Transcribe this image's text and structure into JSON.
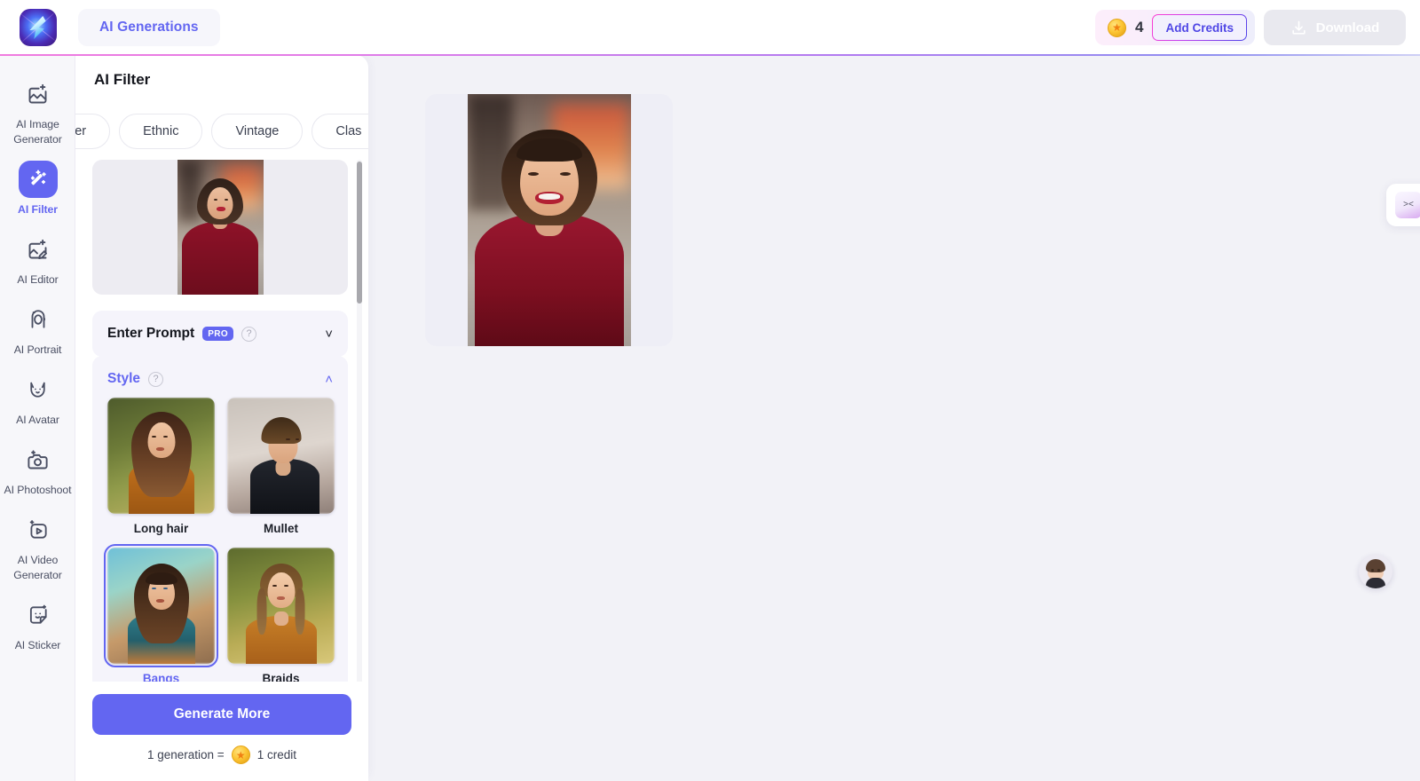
{
  "header": {
    "logo_icon": "app-logo-bird",
    "generations_tab": "AI Generations",
    "credit_icon": "coin-icon",
    "credit_count": "4",
    "add_credits_label": "Add Credits",
    "download_icon": "download-icon",
    "download_label": "Download"
  },
  "sidebar": {
    "items": [
      {
        "label": "AI Image Generator",
        "icon": "image-sparkle-icon",
        "active": false
      },
      {
        "label": "AI Filter",
        "icon": "magic-wand-icon",
        "active": true
      },
      {
        "label": "AI Editor",
        "icon": "image-pencil-icon",
        "active": false
      },
      {
        "label": "AI Portrait",
        "icon": "portrait-frame-icon",
        "active": false
      },
      {
        "label": "AI Avatar",
        "icon": "cat-avatar-icon",
        "active": false
      },
      {
        "label": "AI Photoshoot",
        "icon": "camera-sparkle-icon",
        "active": false
      },
      {
        "label": "AI Video Generator",
        "icon": "video-play-icon",
        "active": false
      },
      {
        "label": "AI Sticker",
        "icon": "sticker-smiley-icon",
        "active": false
      }
    ]
  },
  "panel": {
    "title": "AI Filter",
    "tabs": [
      {
        "label": "aracter",
        "clipped": true
      },
      {
        "label": "Ethnic",
        "clipped": false
      },
      {
        "label": "Vintage",
        "clipped": false
      },
      {
        "label": "Clas",
        "clipped": false
      }
    ],
    "source_image_alt": "uploaded portrait of smiling woman in dark red turtleneck",
    "prompt_section": {
      "label": "Enter Prompt",
      "badge": "PRO",
      "help_icon": "question-mark-icon",
      "chevron_icon": "chevron-down-icon",
      "expanded": false
    },
    "style_section": {
      "label": "Style",
      "help_icon": "question-mark-icon",
      "chevron_icon": "chevron-up-icon",
      "expanded": true,
      "options": [
        {
          "name": "Long hair",
          "selected": false,
          "art": "green"
        },
        {
          "name": "Mullet",
          "selected": false,
          "art": "city"
        },
        {
          "name": "Bangs",
          "selected": true,
          "art": "bangs"
        },
        {
          "name": "Braids",
          "selected": false,
          "art": "field"
        }
      ]
    },
    "generate_label": "Generate More",
    "credit_note_prefix": "1 generation =",
    "credit_note_icon": "coin-icon",
    "credit_note_suffix": "1 credit"
  },
  "canvas": {
    "preview_alt": "generated portrait with bob haircut and bangs in dark red turtleneck",
    "side_widget_icon": "emoticon-face-icon",
    "assistant_icon": "assistant-avatar-icon"
  },
  "colors": {
    "accent": "#6366f1",
    "canvas_bg": "#f2f2f7",
    "sidebar_bg": "#f7f7fa",
    "panel_bg": "#ffffff",
    "section_bg": "#f5f4fb"
  }
}
